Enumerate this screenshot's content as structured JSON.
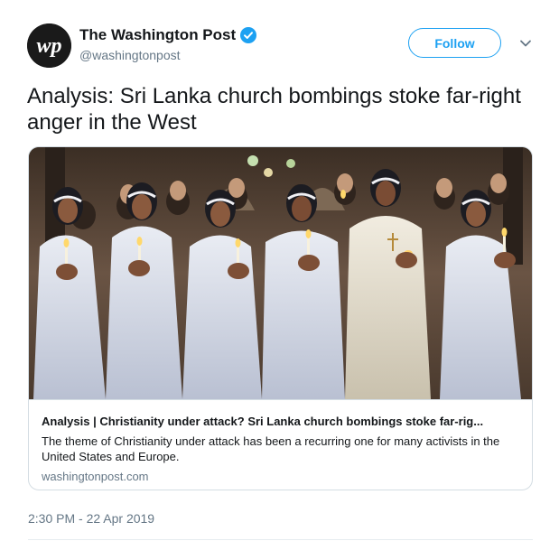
{
  "account": {
    "display_name": "The Washington Post",
    "handle": "@washingtonpost",
    "avatar_logo_text": "wp",
    "verified": true
  },
  "actions": {
    "follow_label": "Follow",
    "more_icon": "chevron-down-icon"
  },
  "tweet": {
    "text": "Analysis: Sri Lanka church bombings stoke far-right anger in the West",
    "timestamp": "2:30 PM - 22 Apr 2019"
  },
  "card": {
    "title": "Analysis | Christianity under attack? Sri Lanka church bombings stoke far-rig...",
    "description": "The theme of Christianity under attack has been a recurring one for many activists in the United States and Europe.",
    "domain": "washingtonpost.com"
  },
  "colors": {
    "accent": "#1da1f2",
    "text_primary": "#14171a",
    "text_secondary": "#657786",
    "border": "#d4dde3"
  }
}
